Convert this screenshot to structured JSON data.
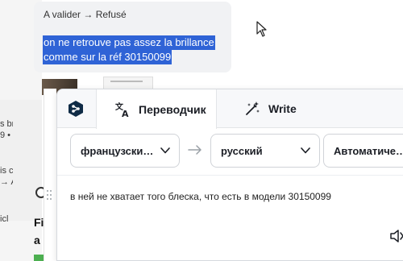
{
  "comment": {
    "status": "A valider → Refusé",
    "selected_line1": "on ne retrouve pas assez la brillance",
    "selected_line2": "comme sur la réf 30150099"
  },
  "background": {
    "frag1": "s br",
    "frag2": "9 •",
    "frag3": "is c",
    "frag4": "→ A",
    "frag5": "icl",
    "bold1": "Fi",
    "bold2": "a"
  },
  "popup": {
    "tabs": [
      {
        "label": "Переводчик",
        "icon": "translate-icon"
      },
      {
        "label": "Write",
        "icon": "magic-wand-icon"
      }
    ],
    "source_language": "французски…",
    "target_language": "русский",
    "mode": "Автоматиче…",
    "translation": "в ней не хватает того блеска, что есть в модели 30150099"
  },
  "colors": {
    "selection": "#2f63d6",
    "logo": "#0f2b46"
  }
}
